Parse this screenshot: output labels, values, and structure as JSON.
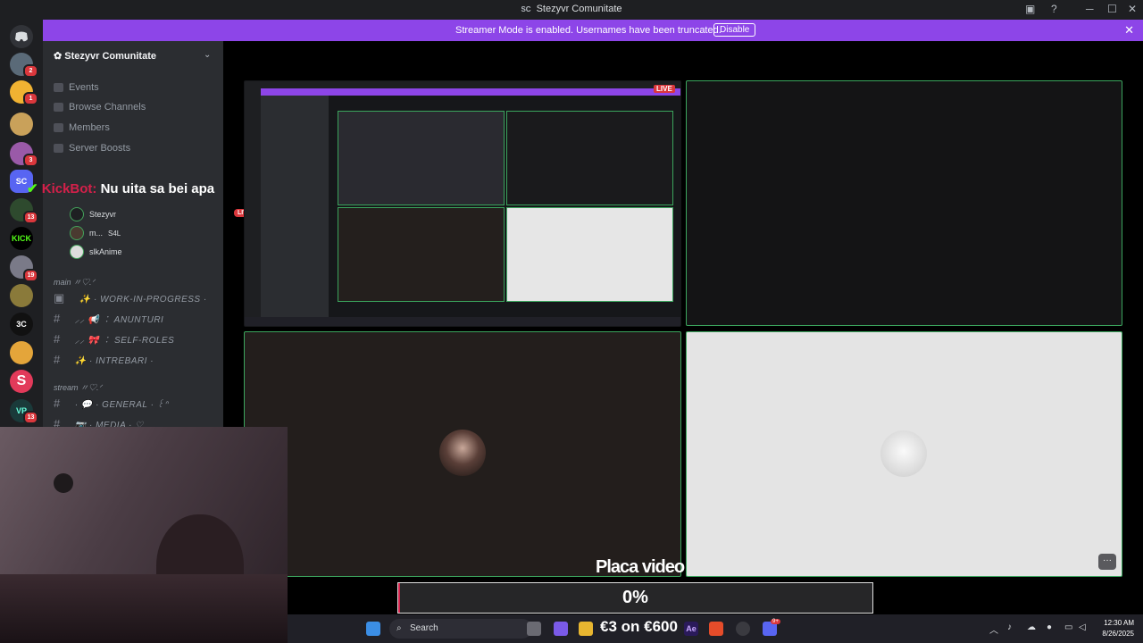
{
  "window": {
    "title": "Stezyvr Comunitate",
    "app_abbrev": "SC"
  },
  "banner": {
    "message": "Streamer Mode is enabled. Usernames have been truncated.",
    "button": "Disable"
  },
  "rail_badges": [
    "2",
    "1",
    "3",
    "13",
    "19",
    "13"
  ],
  "rail_labels": {
    "kick": "KICK",
    "three_c": "3C",
    "vp": "VP"
  },
  "server": {
    "name": "Stezyvr Comunitate"
  },
  "nav": [
    "Events",
    "Browse Channels",
    "Members",
    "Server Boosts"
  ],
  "voice_users": [
    {
      "name": "Stezyvr",
      "live": "LIVE"
    },
    {
      "name": "m...",
      "tag": "S4L"
    },
    {
      "name": "slkAnime"
    }
  ],
  "categories": [
    {
      "name": "main 〃♡.ᐟ",
      "channels": [
        "✨ · WORK-IN-PROGRESS ·",
        "⸝⸝ 📢 ︰ ANUNTURI",
        "⸝⸝ 🎀 ︰ SELF-ROLES",
        "✨ · INTREBARI ·"
      ]
    },
    {
      "name": "stream 〃♡.ᐟ",
      "channels": [
        "· 💬 · GENERAL · ꒰ᐢ",
        "📷 · MEDIA · ♡"
      ]
    }
  ],
  "kickbot": {
    "name": "KickBot:",
    "message": "Nu uita sa bei apa"
  },
  "stream": {
    "live_badge": "LIVE"
  },
  "overlay": {
    "title": "Placa video",
    "progress_pct": 0,
    "progress_label": "0%"
  },
  "taskbar": {
    "search_placeholder": "Search",
    "price_text": "€3 on €600",
    "ae_label": "Ae",
    "discord_badge": "9+",
    "time": "12:30 AM",
    "date": "8/26/2025"
  },
  "colors": {
    "accent": "#8d45e8",
    "live": "#da373c",
    "speaking": "#3ba55d",
    "kick": "#53fc18"
  }
}
